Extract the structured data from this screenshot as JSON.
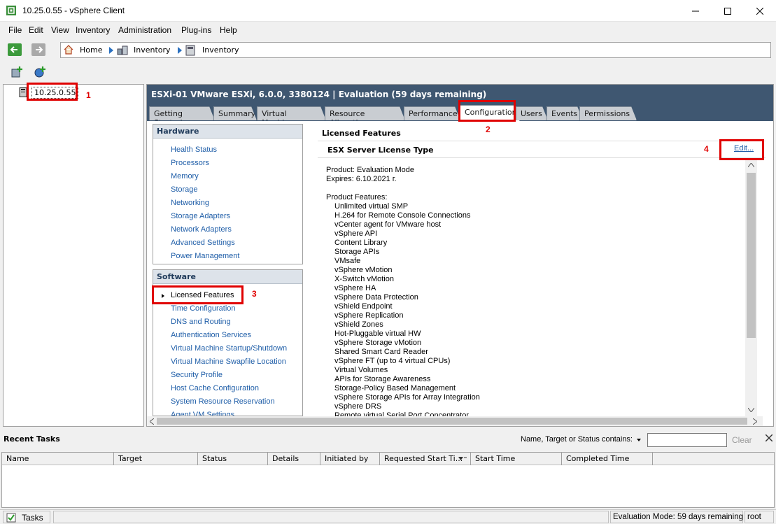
{
  "window": {
    "title": "10.25.0.55 - vSphere Client"
  },
  "menu": [
    "File",
    "Edit",
    "View",
    "Inventory",
    "Administration",
    "Plug-ins",
    "Help"
  ],
  "breadcrumb": {
    "home": "Home",
    "inv1": "Inventory",
    "inv2": "Inventory"
  },
  "tree": {
    "host": "10.25.0.55"
  },
  "host_header": "ESXi-01 VMware ESXi, 6.0.0, 3380124 | Evaluation (59 days remaining)",
  "tabs": [
    "Getting Started",
    "Summary",
    "Virtual Machines",
    "Resource Allocation",
    "Performance",
    "Configuration",
    "Users",
    "Events",
    "Permissions"
  ],
  "hardware": {
    "title": "Hardware",
    "items": [
      "Health Status",
      "Processors",
      "Memory",
      "Storage",
      "Networking",
      "Storage Adapters",
      "Network Adapters",
      "Advanced Settings",
      "Power Management"
    ]
  },
  "software": {
    "title": "Software",
    "items": [
      "Licensed Features",
      "Time Configuration",
      "DNS and Routing",
      "Authentication Services",
      "Virtual Machine Startup/Shutdown",
      "Virtual Machine Swapfile Location",
      "Security Profile",
      "Host Cache Configuration",
      "System Resource Reservation",
      "Agent VM Settings"
    ]
  },
  "licensed": {
    "title": "Licensed Features",
    "subtitle": "ESX Server License Type",
    "edit": "Edit...",
    "product": "Product: Evaluation Mode",
    "expires": "Expires: 6.10.2021 г.",
    "features_title": "Product Features:",
    "features": [
      "Unlimited virtual SMP",
      "H.264 for Remote Console Connections",
      "vCenter agent for VMware host",
      "vSphere API",
      "Content Library",
      "Storage APIs",
      "VMsafe",
      "vSphere vMotion",
      "X-Switch vMotion",
      "vSphere HA",
      "vSphere Data Protection",
      "vShield Endpoint",
      "vSphere Replication",
      "vShield Zones",
      "Hot-Pluggable virtual HW",
      "vSphere Storage vMotion",
      "Shared Smart Card Reader",
      "vSphere FT (up to 4 virtual CPUs)",
      "Virtual Volumes",
      "APIs for Storage Awareness",
      "Storage-Policy Based Management",
      "vSphere Storage APIs for Array Integration",
      "vSphere DRS",
      "Remote virtual Serial Port Concentrator"
    ]
  },
  "annotations": [
    "1",
    "2",
    "3",
    "4"
  ],
  "recent": {
    "title": "Recent Tasks",
    "filter_label": "Name, Target or Status contains:",
    "clear": "Clear",
    "columns": [
      "Name",
      "Target",
      "Status",
      "Details",
      "Initiated by",
      "Requested Start Ti...",
      "Start Time",
      "Completed Time"
    ]
  },
  "status": {
    "tasks": "Tasks",
    "eval": "Evaluation Mode: 59 days remaining",
    "user": "root"
  },
  "colors": {
    "header_bg": "#3f5771",
    "link": "#1f5ea8",
    "annotation": "#e00000"
  }
}
